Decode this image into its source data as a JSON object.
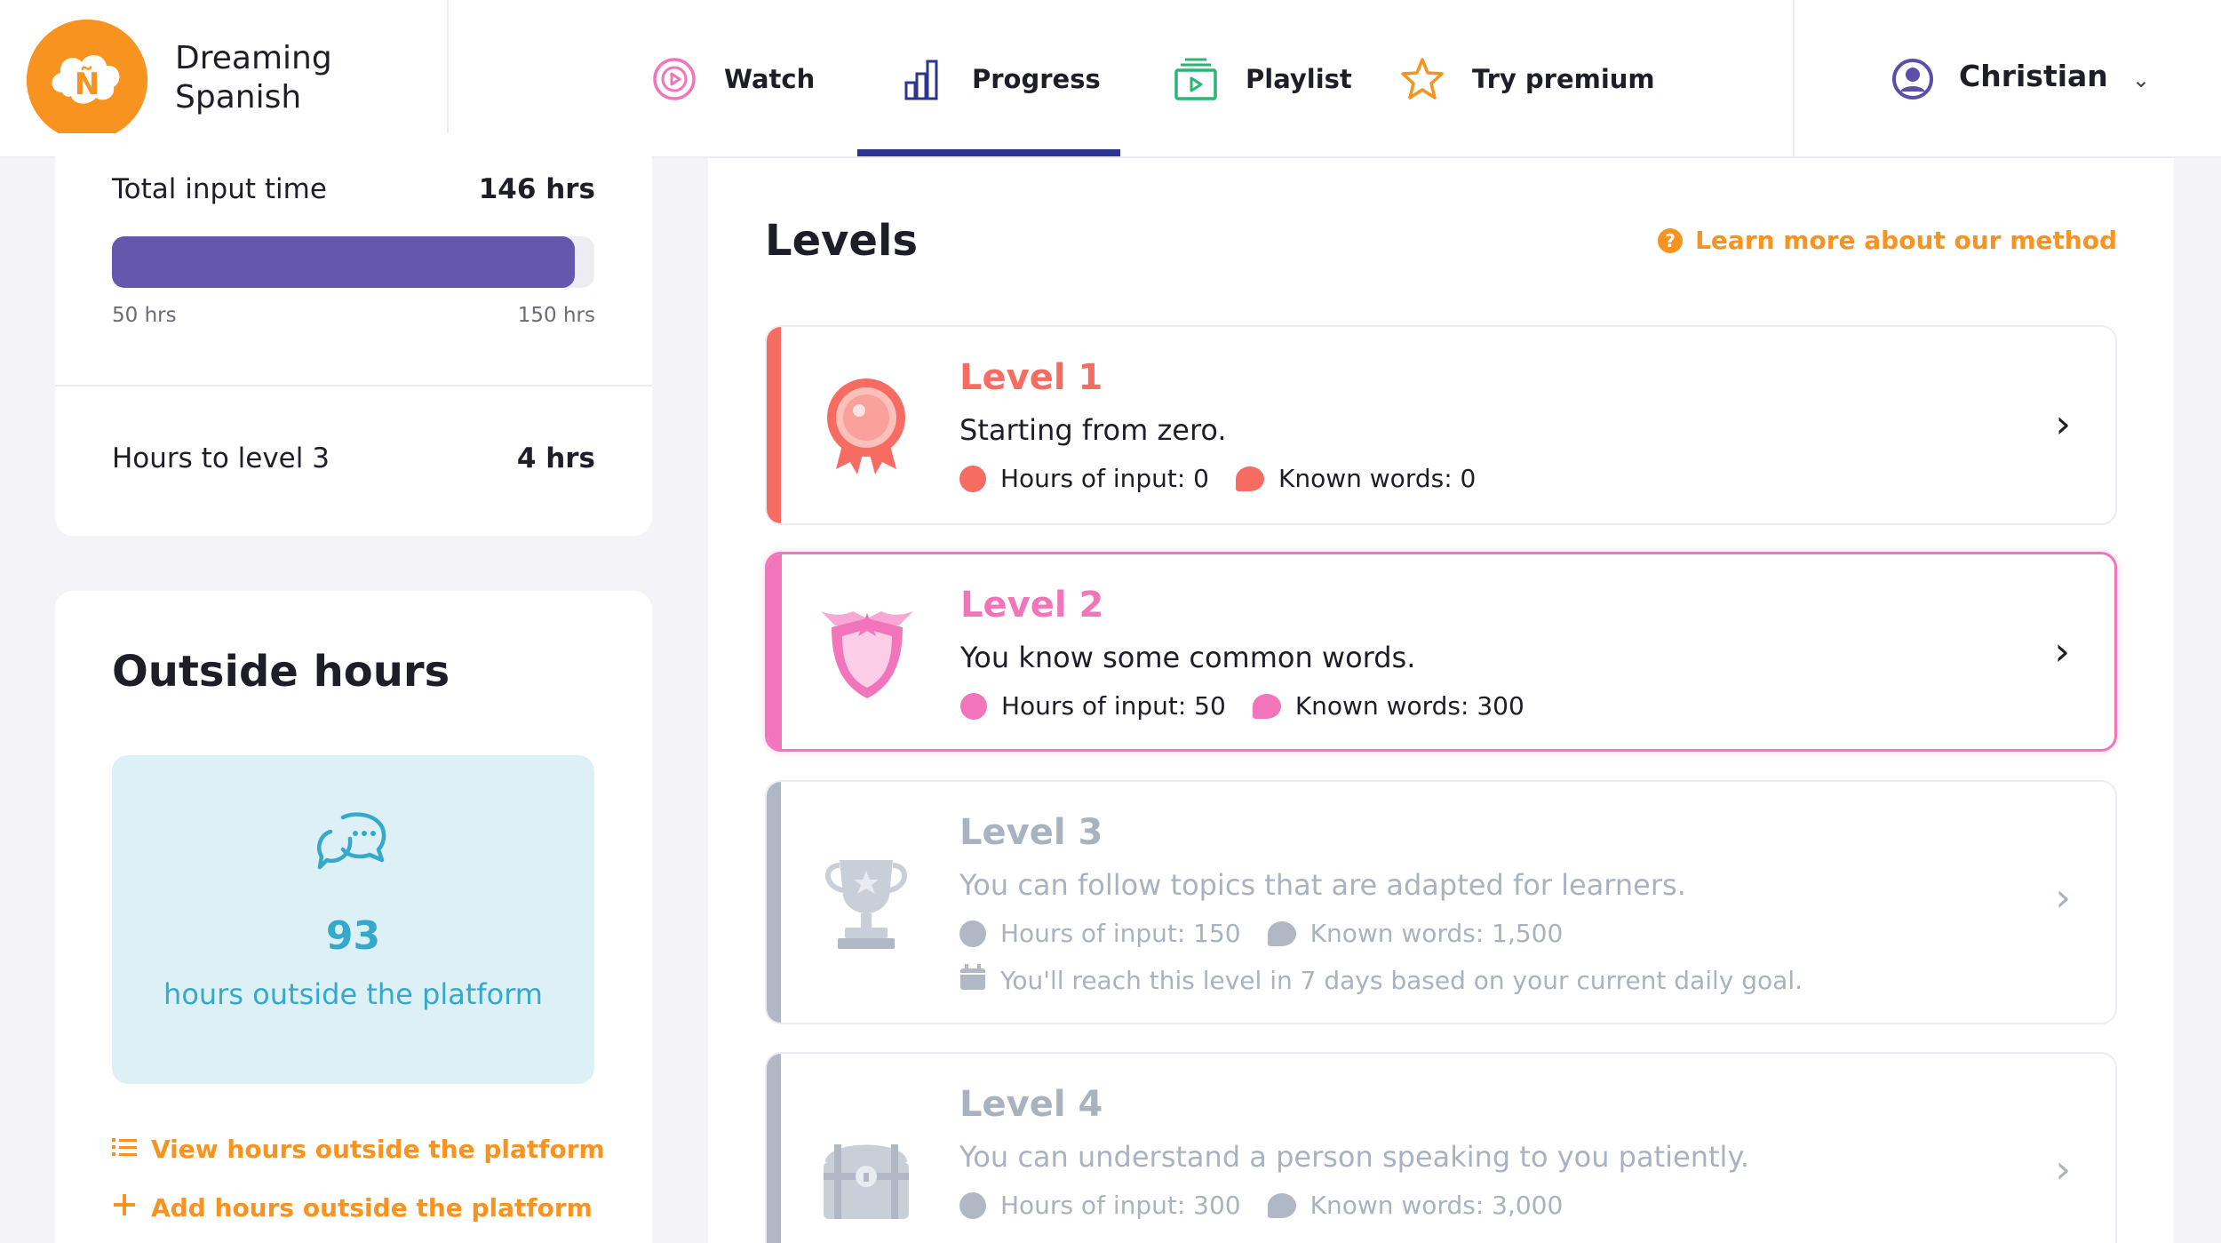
{
  "brand": {
    "logo_letter": "Ñ",
    "name": "Dreaming Spanish",
    "color": "#f7931e"
  },
  "nav": {
    "items": [
      {
        "label": "Watch",
        "icon": "play-circle-icon"
      },
      {
        "label": "Progress",
        "icon": "bar-chart-icon",
        "active": true
      },
      {
        "label": "Playlist",
        "icon": "playlist-icon"
      },
      {
        "label": "Try premium",
        "icon": "star-icon"
      }
    ],
    "active_color": "#2c3590"
  },
  "user": {
    "name": "Christian",
    "icon": "user-avatar-icon"
  },
  "progress_card": {
    "total_label": "Total input time",
    "total_value": "146 hrs",
    "bar_min": "50 hrs",
    "bar_max": "150 hrs",
    "bar_fraction": 0.96,
    "bar_color": "#6557ac",
    "to_level_label": "Hours to level 3",
    "to_level_value": "4 hrs"
  },
  "outside": {
    "title": "Outside hours",
    "number": "93",
    "caption": "hours outside the platform",
    "view_link": "View hours outside the platform",
    "add_link": "Add hours outside the platform",
    "accent": "#35a9c9"
  },
  "levels": {
    "title": "Levels",
    "learn_more": "Learn more about our method",
    "items": [
      {
        "name": "Level 1",
        "desc": "Starting from zero.",
        "hours": "Hours of input: 0",
        "words": "Known words: 0",
        "color": "#f66c63"
      },
      {
        "name": "Level 2",
        "desc": "You know some common words.",
        "hours": "Hours of input: 50",
        "words": "Known words: 300",
        "color": "#f275bb"
      },
      {
        "name": "Level 3",
        "desc": "You can follow topics that are adapted for learners.",
        "hours": "Hours of input: 150",
        "words": "Known words: 1,500",
        "note": "You'll reach this level in 7 days based on your current daily goal.",
        "color": "#a9b2bf"
      },
      {
        "name": "Level 4",
        "desc": "You can understand a person speaking to you patiently.",
        "hours": "Hours of input: 300",
        "words": "Known words: 3,000",
        "color": "#a9b2bf"
      }
    ]
  }
}
